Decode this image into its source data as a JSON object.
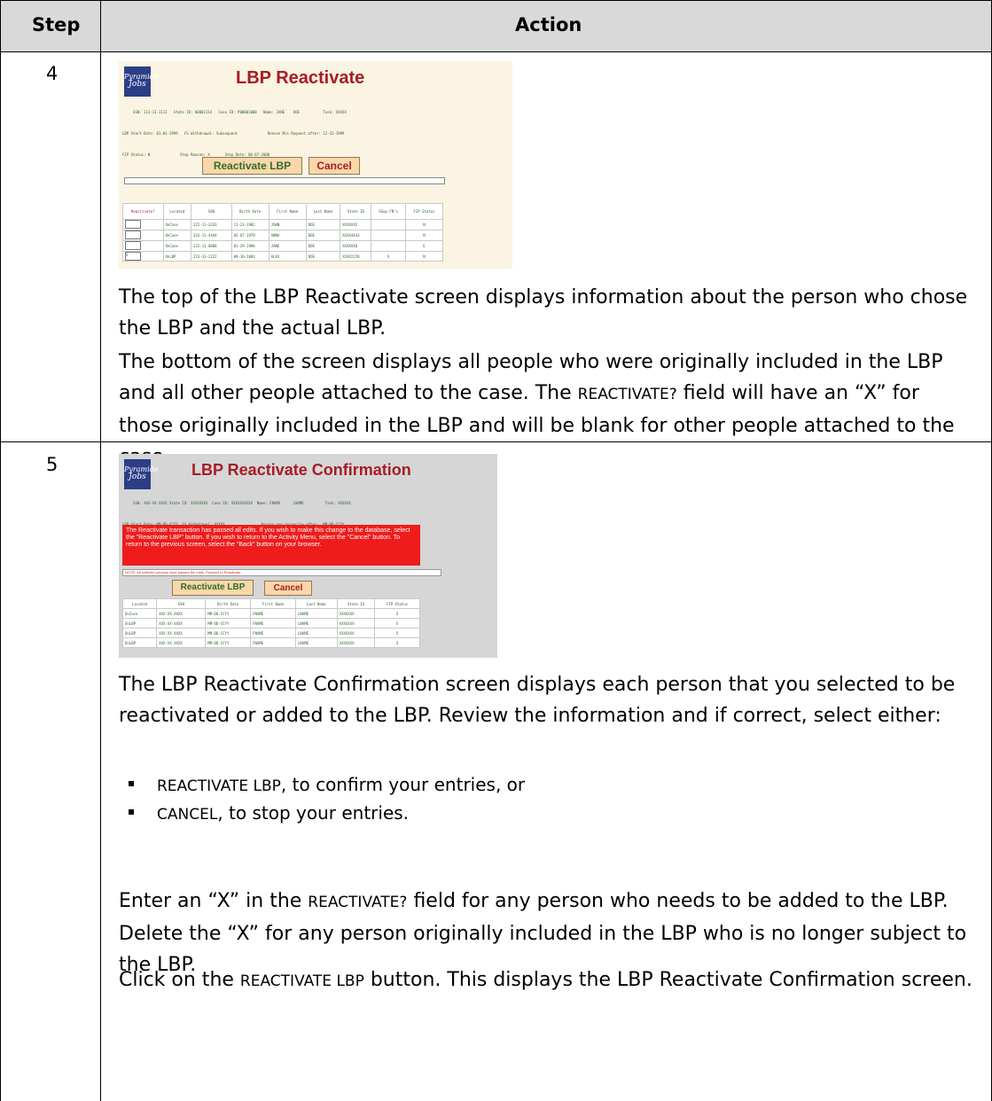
{
  "table": {
    "col_step": "Step",
    "col_action": "Action"
  },
  "rows": [
    {
      "step": "4",
      "screenshot": {
        "logo_line1": "Pyramide",
        "logo_line2": "Jobs",
        "title": "LBP Reactivate",
        "info_lines": [
          "     SSN: 111-11-1111   State ID: 00001114   Case ID: P00001000   Name: JANE    DOE           Task: XXXXX",
          "LBP Start Date: 01-01-1999   FS Withdrawal: Subsequent              Reason Mis Request after: 12-31-1999",
          "FIP Status: N              Stop Reason: X       Stop Date: 06-07-2000"
        ],
        "reactivate_button": "Reactivate LBP",
        "cancel_button": "Cancel",
        "columns": [
          "Reactivate?",
          "Located",
          "SSN",
          "Birth Date",
          "First Name",
          "Last Name",
          "State ID",
          "SSop FN's",
          "FIP Status"
        ],
        "rows": [
          {
            "reactivate": "",
            "located": "OnCase",
            "ssn": "222-11-3333",
            "birth": "11-23-1982",
            "first": "JOHN",
            "last": "DOE",
            "state_id": "XXXXXXX",
            "ssop": "",
            "fip": "N"
          },
          {
            "reactivate": "",
            "located": "OnCase",
            "ssn": "333-11-4444",
            "birth": "05-07-1979",
            "first": "ANNA",
            "last": "DOE",
            "state_id": "XXXX4443",
            "ssop": "",
            "fip": "N"
          },
          {
            "reactivate": "",
            "located": "OnCase",
            "ssn": "222-11-8888",
            "birth": "01-29-1980",
            "first": "JANE",
            "last": "DOE",
            "state_id": "XXXXXX8",
            "ssop": "",
            "fip": "E"
          },
          {
            "reactivate": "X",
            "located": "OnLBP",
            "ssn": "223-33-2222",
            "birth": "09-10-2003",
            "first": "ALEX",
            "last": "DOE",
            "state_id": "XXXX2228",
            "ssop": "X",
            "fip": "N"
          }
        ]
      },
      "paragraphs": [
        [
          {
            "t": "The top of the LBP Reactivate screen displays information about the person who chose the LBP and the actual LBP."
          }
        ],
        [
          {
            "t": "The bottom of the screen displays all people who were originally included in the LBP and all other people attached to the case. The "
          },
          {
            "t": "REACTIVATE?",
            "sc": true
          },
          {
            "t": " field will have an “X” for those originally included in the LBP and will be blank for other people attached to the case."
          }
        ],
        [
          {
            "t": "Enter an “X” in the "
          },
          {
            "t": "REACTIVATE?",
            "sc": true
          },
          {
            "t": " field for any person who needs to be added to the LBP. Delete the “X” for any person originally included in the LBP who is no longer subject to the LBP."
          }
        ],
        [
          {
            "t": "Click on the "
          },
          {
            "t": "REACTIVATE LBP",
            "sc": true
          },
          {
            "t": " button. This displays the LBP Reactivate Confirmation screen."
          }
        ]
      ]
    },
    {
      "step": "5",
      "screenshot": {
        "logo_line1": "Pyramide",
        "logo_line2": "Jobs",
        "title": "LBP Reactivate Confirmation",
        "info_lines": [
          "     SSN: XXX-XX-XXXX State ID: XXXXXXXX  Case ID: XXXXXXXXXX  Name: FNAME      LNAME          Task: XXXXXX",
          "LBP Start Date: MM-DD-CCYY  FS Withdrawal: XXXXX                 Person non-reconcile after:  MM-DD-CCYY",
          "FIP Status: N          Stop Reason: X         Stop Date: MM-DD-CCYY"
        ],
        "message": "The Reactivate transaction has passed all edits.  If you wish to make this change to the database, select the \"Reactivate LBP\" button.  If you wish to return to the Activity Menu, select the \"Cancel\" button.  To return to the previous screen, select the \"Back\" button on your browser.",
        "note": "NOTE: All selected persons have passed the edits. Proceed to Reactivate.",
        "reactivate_button": "Reactivate LBP",
        "cancel_button": "Cancel",
        "columns": [
          "Located",
          "SSN",
          "Birth Date",
          "First Name",
          "Last Name",
          "State ID",
          "FIP Status"
        ],
        "rows": [
          {
            "located": "OnCase",
            "ssn": "XXX-XX-XXXX",
            "birth": "MM-DD-CCYY",
            "first": "FNAME",
            "last": "LNAME",
            "state_id": "XXXXXXX",
            "fip": "X"
          },
          {
            "located": "OnLBP",
            "ssn": "XXX-XX-XXXX",
            "birth": "MM-DD-CCYY",
            "first": "FNAME",
            "last": "LNAME",
            "state_id": "XXXXXXX",
            "fip": "X"
          },
          {
            "located": "OnLBP",
            "ssn": "XXX-XX-XXXX",
            "birth": "MM-DD-CCYY",
            "first": "FNAME",
            "last": "LNAME",
            "state_id": "XXXXXXX",
            "fip": "X"
          },
          {
            "located": "OnLBP",
            "ssn": "XXX-XX-XXXX",
            "birth": "MM-DD-CCYY",
            "first": "FNAME",
            "last": "LNAME",
            "state_id": "XXXXXXX",
            "fip": "X"
          }
        ]
      },
      "paragraphs": [
        [
          {
            "t": "The LBP Reactivate Confirmation screen displays each person that you selected to be reactivated or added to the LBP. Review the information and if correct, select either:"
          }
        ]
      ],
      "bullets": [
        [
          {
            "t": "REACTIVATE LBP",
            "sc": true
          },
          {
            "t": ", to confirm your entries, or"
          }
        ],
        [
          {
            "t": "CANCEL",
            "sc": true
          },
          {
            "t": ", to stop your entries."
          }
        ]
      ]
    }
  ],
  "colors": {
    "header_bg": "#d9d9d9",
    "screen1_bg": "#fbf4e2",
    "screen2_bg": "#d6d6d6",
    "title_red": "#a61c26",
    "message_red": "#ee1c1c",
    "logo_blue": "#2b3e86"
  }
}
